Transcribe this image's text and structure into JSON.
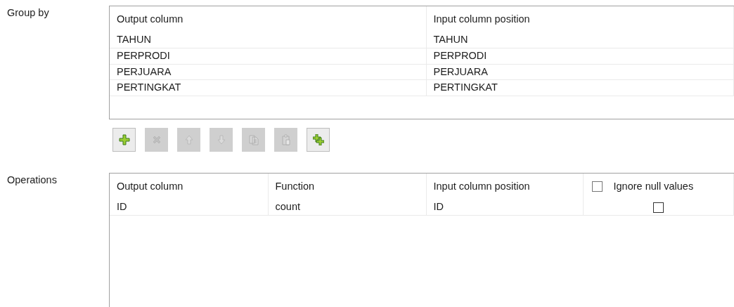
{
  "group_by": {
    "label": "Group by",
    "columns": [
      "Output column",
      "Input column position"
    ],
    "rows": [
      [
        "TAHUN",
        "TAHUN"
      ],
      [
        "PERPRODI",
        "PERPRODI"
      ],
      [
        "PERJUARA",
        "PERJUARA"
      ],
      [
        "PERTINGKAT",
        "PERTINGKAT"
      ]
    ]
  },
  "toolbar": [
    {
      "kind": "add",
      "disabled": false
    },
    {
      "kind": "remove",
      "disabled": true
    },
    {
      "kind": "up",
      "disabled": true
    },
    {
      "kind": "down",
      "disabled": true
    },
    {
      "kind": "copy",
      "disabled": true
    },
    {
      "kind": "paste",
      "disabled": true
    },
    {
      "kind": "add_all",
      "disabled": false
    }
  ],
  "operations": {
    "label": "Operations",
    "columns": [
      {
        "label": "Output column"
      },
      {
        "label": "Function"
      },
      {
        "label": "Input column position"
      },
      {
        "label": "Ignore null values",
        "kind": "checkbox",
        "checked": false
      }
    ],
    "rows": [
      {
        "output_column": "ID",
        "function": "count",
        "input_column_position": "ID",
        "ignore_null_values": false
      }
    ]
  }
}
